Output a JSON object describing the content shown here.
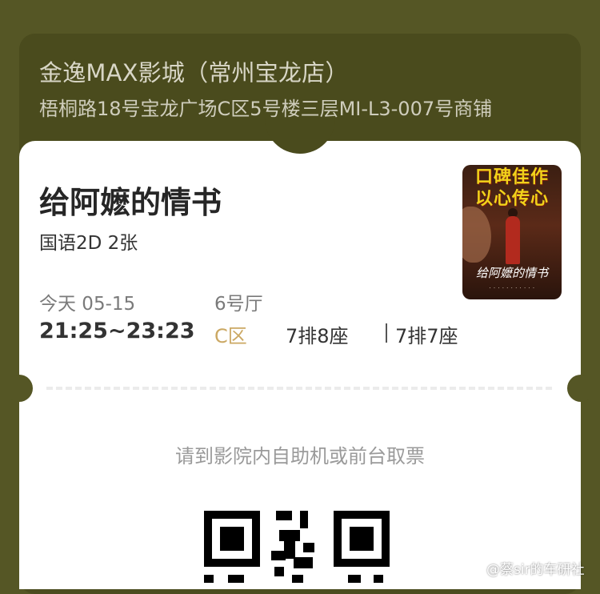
{
  "cinema": {
    "name": "金逸MAX影城（常州宝龙店）",
    "address": "梧桐路18号宝龙广场C区5号楼三层MI-L3-007号商铺"
  },
  "movie": {
    "title": "给阿嬷的情书",
    "format": "国语2D 2张",
    "poster": {
      "slogan_line1": "口碑佳作",
      "slogan_line2": "以心传心",
      "title": "给阿嬷的情书"
    }
  },
  "show": {
    "date": "今天 05-15",
    "time": "21:25~23:23",
    "hall": "6号厅",
    "zone": "C区",
    "seats": [
      "7排8座",
      "7排7座"
    ]
  },
  "pickup": {
    "note": "请到影院内自助机或前台取票"
  },
  "watermark": {
    "text": "@蔡sir的车研社"
  },
  "colors": {
    "frame": "#555625",
    "header": "#4a4b1d",
    "zone_accent": "#cba863"
  }
}
